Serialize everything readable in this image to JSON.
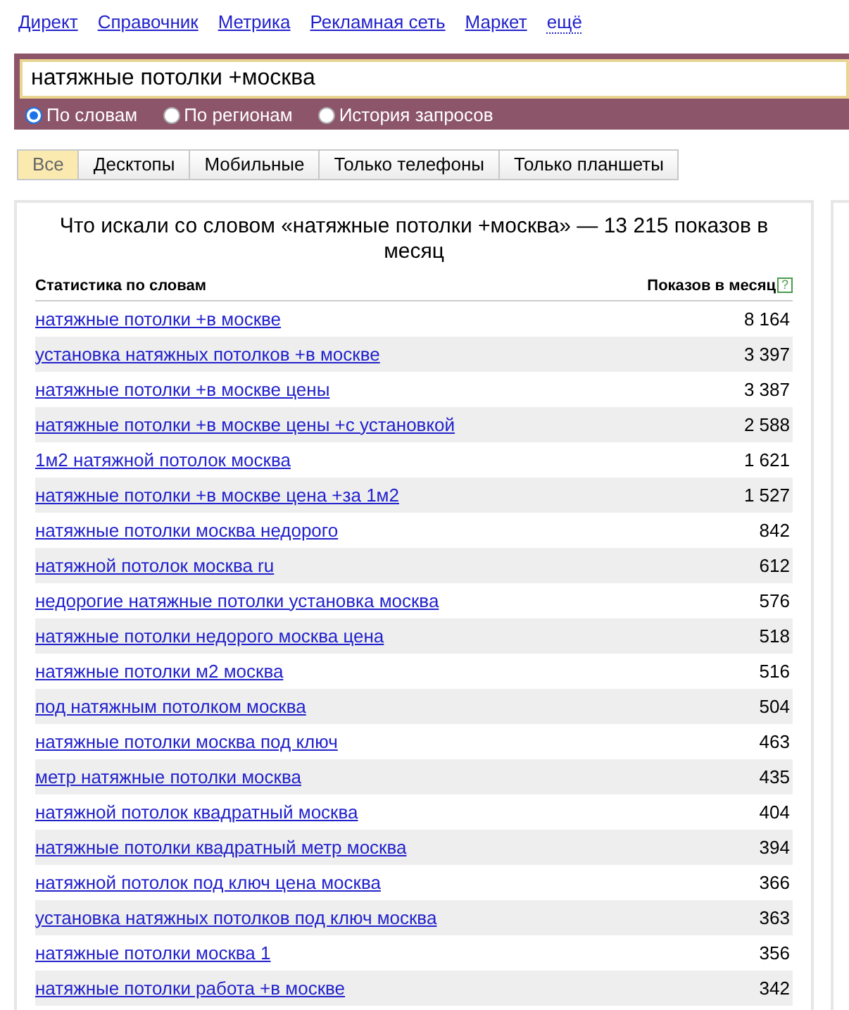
{
  "nav": [
    {
      "label": "Директ",
      "kind": "link"
    },
    {
      "label": "Справочник",
      "kind": "link"
    },
    {
      "label": "Метрика",
      "kind": "link"
    },
    {
      "label": "Рекламная сеть",
      "kind": "link"
    },
    {
      "label": "Маркет",
      "kind": "link"
    },
    {
      "label": "ещё",
      "kind": "more"
    }
  ],
  "search": {
    "value": "натяжные потолки +москва"
  },
  "modes": [
    {
      "label": "По словам",
      "selected": true
    },
    {
      "label": "По регионам",
      "selected": false
    },
    {
      "label": "История запросов",
      "selected": false
    }
  ],
  "tabs": [
    {
      "label": "Все",
      "selected": true
    },
    {
      "label": "Десктопы",
      "selected": false
    },
    {
      "label": "Мобильные",
      "selected": false
    },
    {
      "label": "Только телефоны",
      "selected": false
    },
    {
      "label": "Только планшеты",
      "selected": false
    }
  ],
  "panel": {
    "title": "Что искали со словом «натяжные потолки +москва» — 13 215 показов в месяц",
    "columns": [
      "Статистика по словам",
      "Показов в месяц"
    ],
    "help_mark": "?",
    "rows": [
      {
        "phrase": "натяжные потолки +в москве",
        "count": "8 164"
      },
      {
        "phrase": "установка натяжных потолков +в москве",
        "count": "3 397"
      },
      {
        "phrase": "натяжные потолки +в москве цены",
        "count": "3 387"
      },
      {
        "phrase": "натяжные потолки +в москве цены +с установкой",
        "count": "2 588"
      },
      {
        "phrase": "1м2 натяжной потолок москва",
        "count": "1 621"
      },
      {
        "phrase": "натяжные потолки +в москве цена +за 1м2",
        "count": "1 527"
      },
      {
        "phrase": "натяжные потолки москва недорого",
        "count": "842"
      },
      {
        "phrase": "натяжной потолок москва ru",
        "count": "612"
      },
      {
        "phrase": "недорогие натяжные потолки установка москва",
        "count": "576"
      },
      {
        "phrase": "натяжные потолки недорого москва цена",
        "count": "518"
      },
      {
        "phrase": "натяжные потолки м2 москва",
        "count": "516"
      },
      {
        "phrase": "под натяжным потолком москва",
        "count": "504"
      },
      {
        "phrase": "натяжные потолки москва под ключ",
        "count": "463"
      },
      {
        "phrase": "метр натяжные потолки москва",
        "count": "435"
      },
      {
        "phrase": "натяжной потолок квадратный москва",
        "count": "404"
      },
      {
        "phrase": "натяжные потолки квадратный метр москва",
        "count": "394"
      },
      {
        "phrase": "натяжной потолок под ключ цена москва",
        "count": "366"
      },
      {
        "phrase": "установка натяжных потолков под ключ москва",
        "count": "363"
      },
      {
        "phrase": "натяжные потолки москва 1",
        "count": "356"
      },
      {
        "phrase": "натяжные потолки работа +в москве",
        "count": "342"
      }
    ]
  }
}
